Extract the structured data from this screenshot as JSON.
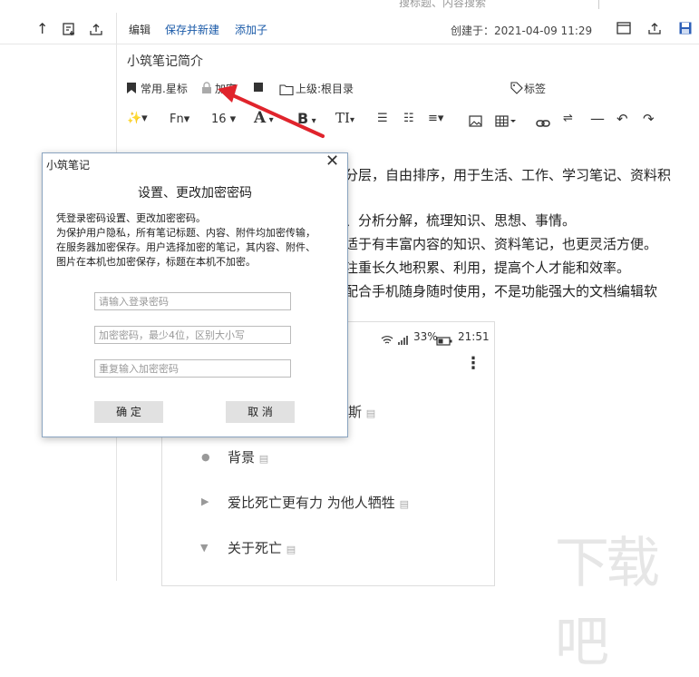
{
  "top": {
    "search_fragment": "搜标题、内容搜索",
    "edit_label": "编辑",
    "save_new_label": "保存并新建",
    "add_child_label": "添加子",
    "created_label": "创建于：2021-04-09 11:29"
  },
  "note": {
    "title": "小筑笔记简介",
    "star_label": "常用.星标",
    "encrypt_label": "加密",
    "parent_label": "上级:根目录",
    "tag_label": "标签",
    "font_label": "Fn",
    "size_label": "16",
    "lines": [
      "分层，自由排序，用于生活、工作、学习笔记、资料积",
      "、分析分解，梳理知识、思想、事情。",
      "适于有丰富内容的知识、资料笔记，也更灵活方便。",
      "注重长久地积累、利用，提高个人才能和效率。",
      "配合手机随身随时使用，不是功能强大的文档编辑软"
    ]
  },
  "phone": {
    "status": "33%",
    "time": "21:51",
    "items": [
      {
        "text": "斯"
      },
      {
        "text": "背景"
      },
      {
        "text": "爱比死亡更有力 为他人牺牲"
      },
      {
        "text": "关于死亡"
      }
    ]
  },
  "dialog": {
    "title": "小筑笔记",
    "heading": "设置、更改加密密码",
    "desc1": "凭登录密码设置、更改加密密码。",
    "desc2": "为保护用户隐私，所有笔记标题、内容、附件均加密传输，",
    "desc3": "在服务器加密保存。用户选择加密的笔记，其内容、附件、",
    "desc4": "图片在本机也加密保存，标题在本机不加密。",
    "login_placeholder": "请输入登录密码",
    "pwd_placeholder": "加密密码，最少4位，区别大小写",
    "repeat_placeholder": "重复输入加密密码",
    "ok_label": "确 定",
    "cancel_label": "取 消"
  },
  "watermark": "下载吧",
  "colors": {
    "accent_blue": "#1a5aa8",
    "arrow_red": "#e0242c"
  }
}
